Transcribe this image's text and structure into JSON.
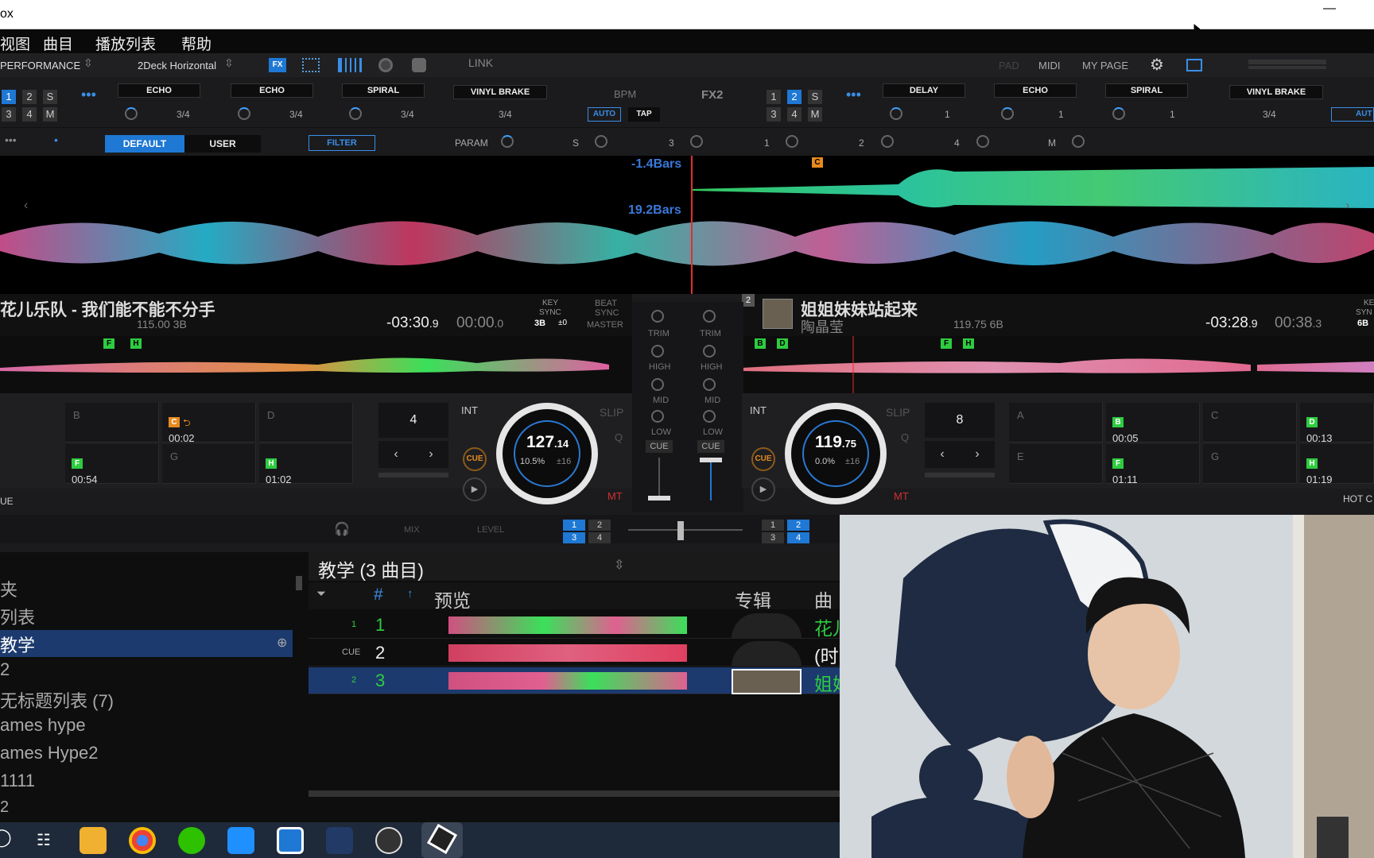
{
  "window": {
    "title": "ox",
    "minimize": "—"
  },
  "menu": [
    "视图",
    "曲目",
    "播放列表",
    "帮助"
  ],
  "toolbar": {
    "mode": "PERFORMANCE",
    "layout": "2Deck Horizontal",
    "link": "LINK",
    "pad": "PAD",
    "midi": "MIDI",
    "mypage": "MY PAGE"
  },
  "fx1": {
    "nums": [
      "1",
      "2",
      "S",
      "3",
      "4",
      "M"
    ],
    "slots": [
      {
        "name": "ECHO",
        "beat": "3/4"
      },
      {
        "name": "ECHO",
        "beat": "3/4"
      },
      {
        "name": "SPIRAL",
        "beat": "3/4"
      }
    ],
    "vinyl": "VINYL BRAKE",
    "vinyl_beat": "3/4",
    "bpm_label": "BPM",
    "auto": "AUTO",
    "tap": "TAP"
  },
  "fx2": {
    "label": "FX2",
    "nums": [
      "1",
      "2",
      "S",
      "3",
      "4",
      "M"
    ],
    "slots": [
      {
        "name": "DELAY",
        "beat": "1"
      },
      {
        "name": "ECHO",
        "beat": "1"
      },
      {
        "name": "SPIRAL",
        "beat": "1"
      }
    ],
    "vinyl": "VINYL BRAKE",
    "vinyl_beat": "3/4",
    "auto": "AUT"
  },
  "fxparams": {
    "default": "DEFAULT",
    "user": "USER",
    "filter": "FILTER",
    "param": "PARAM",
    "s": "S",
    "n3": "3",
    "n1": "1",
    "n2": "2",
    "n4": "4",
    "m": "M"
  },
  "waves": {
    "deck1_offset": "-1.4Bars",
    "deck2_offset": "19.2Bars",
    "cue_tag": "C"
  },
  "deck1": {
    "title": "花儿乐队 - 我们能不能不分手",
    "bpm_key": "115.00 3B",
    "remain": "-03:30",
    "remain_frac": ".9",
    "elapsed": "00:00",
    "elapsed_frac": ".0",
    "key": "KEY",
    "sync": "SYNC",
    "key_val": "3B",
    "key_shift": "±0",
    "beat": "BEAT",
    "beat_sync": "SYNC",
    "master": "MASTER",
    "ov_tags": [
      "F",
      "H"
    ],
    "pads": [
      {
        "lbl": "B",
        "tag": "",
        "time": ""
      },
      {
        "lbl": "",
        "tag": "C",
        "time": "00:02"
      },
      {
        "lbl": "D",
        "tag": "",
        "time": ""
      },
      {
        "lbl": "",
        "tag": "F",
        "time": "00:54"
      },
      {
        "lbl": "G",
        "tag": "",
        "time": ""
      },
      {
        "lbl": "",
        "tag": "H",
        "time": "01:02"
      }
    ],
    "loop": "4",
    "int": "INT",
    "slip": "SLIP",
    "q": "Q",
    "cue": "CUE",
    "mt": "MT",
    "bpm_main": "127",
    "bpm_frac": ".14",
    "pitch": "10.5%",
    "range": "±16",
    "hotcue": "UE"
  },
  "deck2": {
    "num": "2",
    "title": "姐姐妹妹站起来",
    "artist": "陶晶莹",
    "bpm_key": "119.75 6B",
    "remain": "-03:28",
    "remain_frac": ".9",
    "elapsed": "00:38",
    "elapsed_frac": ".3",
    "key_val": "6B",
    "key": "KEY",
    "syn": "SYN",
    "ov_tags": [
      "B",
      "D",
      "F",
      "H"
    ],
    "pads": [
      {
        "lbl": "A",
        "tag": "",
        "time": ""
      },
      {
        "lbl": "",
        "tag": "B",
        "time": "00:05"
      },
      {
        "lbl": "C",
        "tag": "",
        "time": ""
      },
      {
        "lbl": "",
        "tag": "D",
        "time": "00:13"
      },
      {
        "lbl": "E",
        "tag": "",
        "time": ""
      },
      {
        "lbl": "",
        "tag": "F",
        "time": "01:11"
      },
      {
        "lbl": "G",
        "tag": "",
        "time": ""
      },
      {
        "lbl": "",
        "tag": "H",
        "time": "01:19"
      }
    ],
    "loop": "8",
    "int": "INT",
    "slip": "SLIP",
    "q": "Q",
    "cue": "CUE",
    "mt": "MT",
    "bpm_main": "119",
    "bpm_frac": ".75",
    "pitch": "0.0%",
    "range": "±16",
    "hotcue": "HOT C"
  },
  "mixer": {
    "trim": "TRIM",
    "high": "HIGH",
    "mid": "MID",
    "low": "LOW",
    "cue": "CUE",
    "mix": "MIX",
    "level": "LEVEL",
    "xf_left": [
      "1",
      "2",
      "3",
      "4"
    ],
    "xf_right": [
      "1",
      "2",
      "3",
      "4"
    ]
  },
  "browser": {
    "playlist_title": "教学 (3 曲目)",
    "cols": [
      "#",
      "预览",
      "专辑",
      "曲"
    ],
    "sidebar": [
      "夹",
      "列表",
      "教学",
      "2",
      "无标题列表 (7)",
      "ames hype",
      "ames Hype2",
      "1111",
      "2"
    ],
    "tracks": [
      {
        "deck": "1",
        "num": "1",
        "title": "花儿"
      },
      {
        "deck": "CUE",
        "num": "2",
        "title": "(时"
      },
      {
        "deck": "2",
        "num": "3",
        "title": "姐妹"
      }
    ]
  },
  "colors": {
    "accent": "#1e78d4",
    "green": "#39e04a",
    "orange": "#e68a1e",
    "red": "#e03030"
  }
}
